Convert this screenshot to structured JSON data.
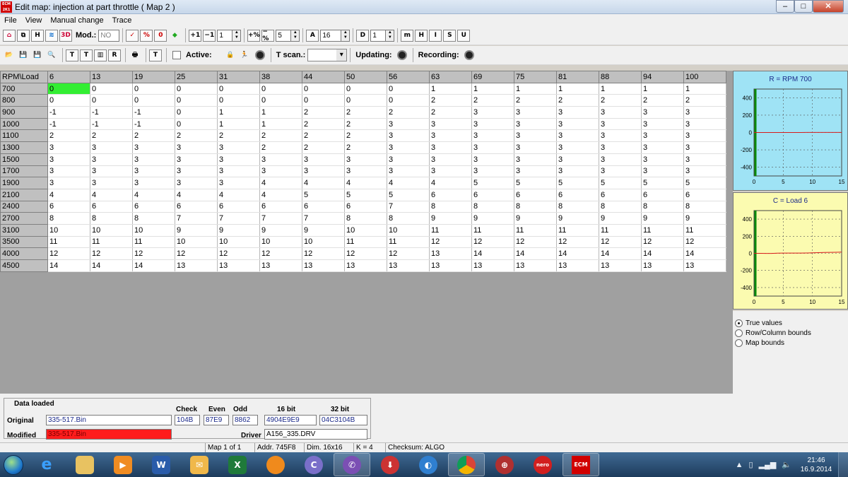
{
  "window": {
    "title": "Edit map: injection at part throttle ( Map 2 )",
    "app_icon_text": "ECM 2K1"
  },
  "menu": [
    "File",
    "View",
    "Manual change",
    "Trace"
  ],
  "toolbar1": {
    "mod_label": "Mod.:",
    "mod_value": "NO",
    "spin1": "1",
    "spin2": "5",
    "spin3": "16",
    "spin4": "1"
  },
  "toolbar2": {
    "active_label": "Active:",
    "tscan_label": "T scan.:",
    "updating_label": "Updating:",
    "recording_label": "Recording:"
  },
  "map": {
    "corner": "RPM\\Load",
    "columns": [
      "6",
      "13",
      "19",
      "25",
      "31",
      "38",
      "44",
      "50",
      "56",
      "63",
      "69",
      "75",
      "81",
      "88",
      "94",
      "100"
    ],
    "rows": [
      {
        "rpm": "700",
        "v": [
          "0",
          "0",
          "0",
          "0",
          "0",
          "0",
          "0",
          "0",
          "0",
          "1",
          "1",
          "1",
          "1",
          "1",
          "1",
          "1"
        ]
      },
      {
        "rpm": "800",
        "v": [
          "0",
          "0",
          "0",
          "0",
          "0",
          "0",
          "0",
          "0",
          "0",
          "2",
          "2",
          "2",
          "2",
          "2",
          "2",
          "2"
        ]
      },
      {
        "rpm": "900",
        "v": [
          "-1",
          "-1",
          "-1",
          "0",
          "1",
          "1",
          "2",
          "2",
          "2",
          "2",
          "3",
          "3",
          "3",
          "3",
          "3",
          "3"
        ]
      },
      {
        "rpm": "1000",
        "v": [
          "-1",
          "-1",
          "-1",
          "0",
          "1",
          "1",
          "2",
          "2",
          "3",
          "3",
          "3",
          "3",
          "3",
          "3",
          "3",
          "3"
        ]
      },
      {
        "rpm": "1100",
        "v": [
          "2",
          "2",
          "2",
          "2",
          "2",
          "2",
          "2",
          "2",
          "3",
          "3",
          "3",
          "3",
          "3",
          "3",
          "3",
          "3"
        ]
      },
      {
        "rpm": "1300",
        "v": [
          "3",
          "3",
          "3",
          "3",
          "3",
          "2",
          "2",
          "2",
          "3",
          "3",
          "3",
          "3",
          "3",
          "3",
          "3",
          "3"
        ]
      },
      {
        "rpm": "1500",
        "v": [
          "3",
          "3",
          "3",
          "3",
          "3",
          "3",
          "3",
          "3",
          "3",
          "3",
          "3",
          "3",
          "3",
          "3",
          "3",
          "3"
        ]
      },
      {
        "rpm": "1700",
        "v": [
          "3",
          "3",
          "3",
          "3",
          "3",
          "3",
          "3",
          "3",
          "3",
          "3",
          "3",
          "3",
          "3",
          "3",
          "3",
          "3"
        ]
      },
      {
        "rpm": "1900",
        "v": [
          "3",
          "3",
          "3",
          "3",
          "3",
          "4",
          "4",
          "4",
          "4",
          "4",
          "5",
          "5",
          "5",
          "5",
          "5",
          "5"
        ]
      },
      {
        "rpm": "2100",
        "v": [
          "4",
          "4",
          "4",
          "4",
          "4",
          "4",
          "5",
          "5",
          "5",
          "6",
          "6",
          "6",
          "6",
          "6",
          "6",
          "6"
        ]
      },
      {
        "rpm": "2400",
        "v": [
          "6",
          "6",
          "6",
          "6",
          "6",
          "6",
          "6",
          "6",
          "7",
          "8",
          "8",
          "8",
          "8",
          "8",
          "8",
          "8"
        ]
      },
      {
        "rpm": "2700",
        "v": [
          "8",
          "8",
          "8",
          "7",
          "7",
          "7",
          "7",
          "8",
          "8",
          "9",
          "9",
          "9",
          "9",
          "9",
          "9",
          "9"
        ]
      },
      {
        "rpm": "3100",
        "v": [
          "10",
          "10",
          "10",
          "9",
          "9",
          "9",
          "9",
          "10",
          "10",
          "11",
          "11",
          "11",
          "11",
          "11",
          "11",
          "11"
        ]
      },
      {
        "rpm": "3500",
        "v": [
          "11",
          "11",
          "11",
          "10",
          "10",
          "10",
          "10",
          "11",
          "11",
          "12",
          "12",
          "12",
          "12",
          "12",
          "12",
          "12"
        ]
      },
      {
        "rpm": "4000",
        "v": [
          "12",
          "12",
          "12",
          "12",
          "12",
          "12",
          "12",
          "12",
          "12",
          "13",
          "14",
          "14",
          "14",
          "14",
          "14",
          "14"
        ]
      },
      {
        "rpm": "4500",
        "v": [
          "14",
          "14",
          "14",
          "13",
          "13",
          "13",
          "13",
          "13",
          "13",
          "13",
          "13",
          "13",
          "13",
          "13",
          "13",
          "13"
        ]
      }
    ]
  },
  "chart_data": [
    {
      "type": "line",
      "title": "R = RPM 700",
      "x": [
        0,
        1,
        2,
        3,
        4,
        5,
        6,
        7,
        8,
        9,
        10,
        11,
        12,
        13,
        14,
        15
      ],
      "series": [
        {
          "values": [
            0,
            0,
            0,
            0,
            0,
            0,
            0,
            0,
            0,
            1,
            1,
            1,
            1,
            1,
            1,
            1
          ]
        }
      ],
      "xlim": [
        0,
        15
      ],
      "ylim": [
        -500,
        500
      ],
      "x_ticks": [
        "0",
        "5",
        "10",
        "15"
      ],
      "y_ticks": [
        "400",
        "200",
        "0",
        "-200",
        "-400"
      ],
      "colors": {
        "bg": "#9fe3f5",
        "line": "#d81b1b",
        "cursor": "#0a8a0a"
      }
    },
    {
      "type": "line",
      "title": "C = Load 6",
      "x": [
        0,
        1,
        2,
        3,
        4,
        5,
        6,
        7,
        8,
        9,
        10,
        11,
        12,
        13,
        14,
        15
      ],
      "series": [
        {
          "values": [
            0,
            0,
            -1,
            -1,
            2,
            3,
            3,
            3,
            3,
            4,
            6,
            8,
            10,
            11,
            12,
            14
          ]
        }
      ],
      "xlim": [
        0,
        15
      ],
      "ylim": [
        -500,
        500
      ],
      "x_ticks": [
        "0",
        "5",
        "10",
        "15"
      ],
      "y_ticks": [
        "400",
        "200",
        "0",
        "-200",
        "-400"
      ],
      "colors": {
        "bg": "#fbfbb0",
        "line": "#d81b1b",
        "cursor": "#0a8a0a"
      }
    }
  ],
  "options": [
    {
      "label": "True values",
      "selected": true
    },
    {
      "label": "Row/Column bounds",
      "selected": false
    },
    {
      "label": "Map bounds",
      "selected": false
    }
  ],
  "data_loaded": {
    "title": "Data loaded",
    "original_label": "Original",
    "original_value": "335-517.Bin",
    "modified_label": "Modified",
    "modified_value": "335-517.Bin",
    "check_label": "Check",
    "check_value": "104B",
    "even_label": "Even",
    "even_value": "87E9",
    "odd_label": "Odd",
    "odd_value": "8862",
    "b16_label": "16 bit",
    "b16_value": "4904E9E9",
    "b32_label": "32 bit",
    "b32_value": "04C3104B",
    "driver_label": "Driver",
    "driver_value": "A156_335.DRV"
  },
  "status": {
    "map": "Map 1 of 1",
    "addr": "Addr. 745F8",
    "dim": "Dim. 16x16",
    "k": "K = 4",
    "checksum": "Checksum: ALGO"
  },
  "taskbar": {
    "apps": [
      "IE",
      "Explorer",
      "Media",
      "Word",
      "Outlook",
      "Excel",
      "Orange",
      "Disc",
      "Viber",
      "Media2",
      "Earth",
      "Chrome",
      "Browser",
      "Nero",
      "ECM"
    ],
    "time": "21:46",
    "date": "16.9.2014"
  }
}
